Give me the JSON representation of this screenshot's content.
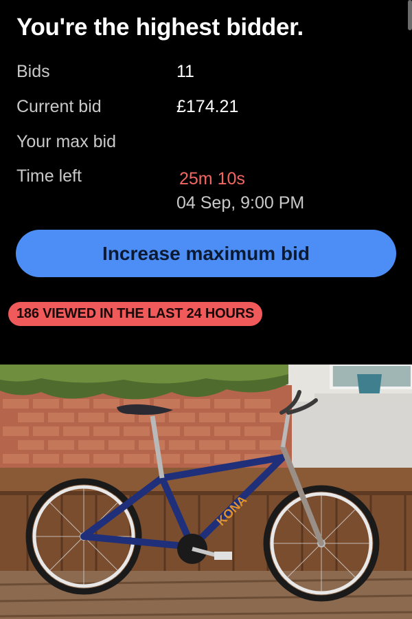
{
  "header": {
    "title": "You're the highest bidder."
  },
  "details": {
    "bids_label": "Bids",
    "bids_value": "11",
    "current_bid_label": "Current bid",
    "current_bid_value": "£174.21",
    "max_bid_label": "Your max bid",
    "max_bid_value": "",
    "time_left_label": "Time left",
    "time_left_value": "25m 10s",
    "end_time": "04 Sep, 9:00 PM"
  },
  "actions": {
    "increase_bid_label": "Increase maximum bid"
  },
  "badge": {
    "views_text": "186 VIEWED IN THE LAST 24 HOURS"
  },
  "listing_photo": {
    "subject": "blue bicycle on wooden deck"
  },
  "colors": {
    "background": "#000000",
    "accent_blue": "#4d8ef6",
    "alert_red": "#f05a5a",
    "time_red": "#f46762"
  }
}
